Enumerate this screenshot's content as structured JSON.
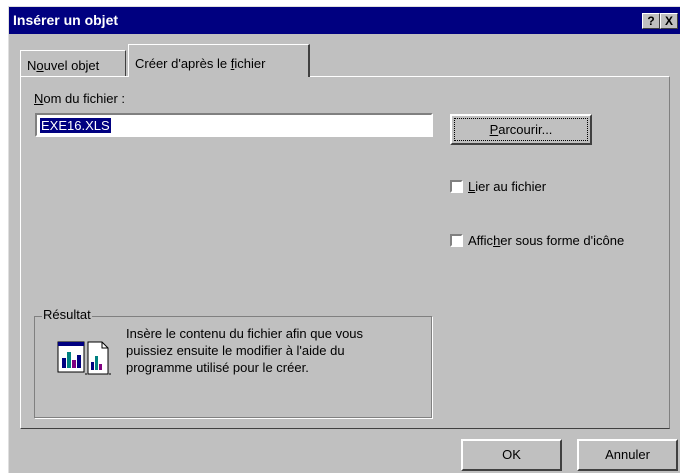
{
  "window": {
    "title": "Insérer un objet",
    "help_label": "?",
    "close_label": "X"
  },
  "tabs": [
    {
      "label_pre": "N",
      "label_ul": "o",
      "label_post": "uvel objet",
      "active": false
    },
    {
      "label_pre": "Créer d'après le ",
      "label_ul": "f",
      "label_post": "ichier",
      "active": true
    }
  ],
  "file": {
    "label_ul": "N",
    "label_post": "om du fichier :",
    "value": "EXE16.XLS"
  },
  "browse_button": {
    "label_ul": "P",
    "label_post": "arcourir..."
  },
  "options": [
    {
      "label_pre": "",
      "label_ul": "L",
      "label_post": "ier au fichier",
      "checked": false
    },
    {
      "label_pre": "Affic",
      "label_ul": "h",
      "label_post": "er sous forme d'icône",
      "checked": false
    }
  ],
  "result": {
    "legend": "Résultat",
    "icon": "excel-document-icon",
    "lines": [
      "Insère le contenu du fichier afin que vous",
      "puissiez ensuite le modifier à l'aide du",
      "programme utilisé pour le créer."
    ]
  },
  "footer": {
    "ok_label": "OK",
    "cancel_label": "Annuler"
  },
  "colors": {
    "titlebar": "#000080",
    "face": "#c0c0c0",
    "selection": "#000080"
  }
}
